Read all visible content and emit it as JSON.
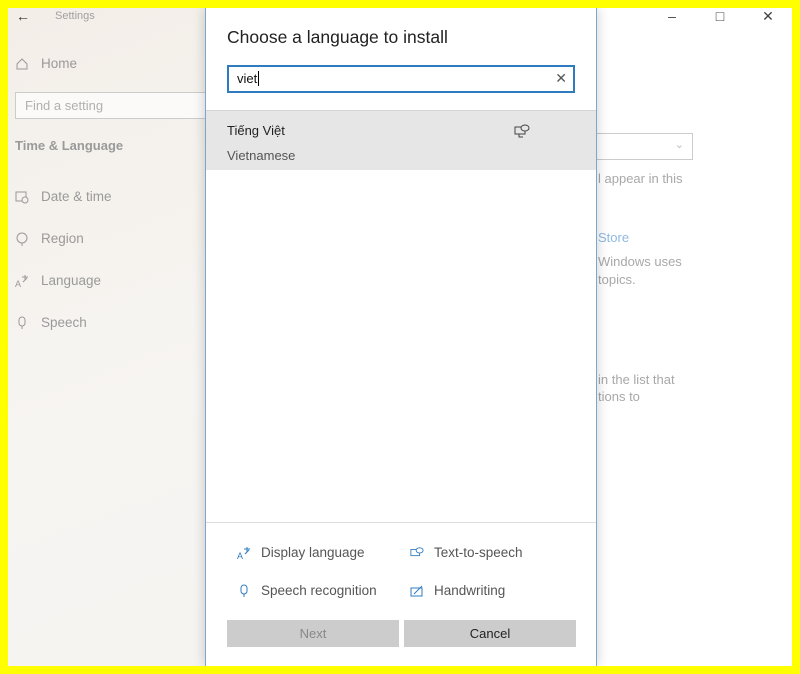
{
  "settings": {
    "title": "Settings",
    "home": "Home",
    "search_placeholder": "Find a setting",
    "section": "Time & Language",
    "nav": [
      {
        "label": "Date & time",
        "icon": "calendar-clock-icon"
      },
      {
        "label": "Region",
        "icon": "globe-icon"
      },
      {
        "label": "Language",
        "icon": "language-icon"
      },
      {
        "label": "Speech",
        "icon": "microphone-icon"
      }
    ],
    "background_text": [
      "l appear in this",
      "Store",
      "Windows uses",
      "topics.",
      "in the list that",
      "tions to"
    ]
  },
  "dialog": {
    "title": "Choose a language to install",
    "search_value": "viet",
    "results": [
      {
        "name": "Tiếng Việt",
        "subtitle": "Vietnamese",
        "feature_icon": "text-to-speech-icon"
      }
    ],
    "features": [
      {
        "label": "Display language",
        "icon": "display-language-icon"
      },
      {
        "label": "Text-to-speech",
        "icon": "text-to-speech-icon"
      },
      {
        "label": "Speech recognition",
        "icon": "microphone-icon"
      },
      {
        "label": "Handwriting",
        "icon": "handwriting-icon"
      }
    ],
    "next_label": "Next",
    "cancel_label": "Cancel"
  },
  "colors": {
    "accent": "#2f7bbf",
    "frame": "#ffff00"
  }
}
